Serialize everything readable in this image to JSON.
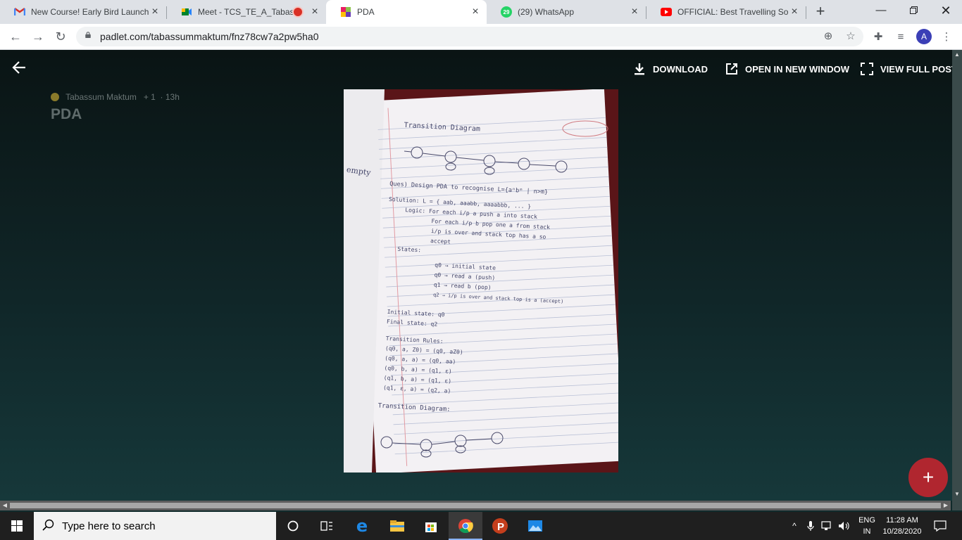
{
  "browser": {
    "tabs": [
      {
        "title": "New Course! Early Bird Launch",
        "icon": "gmail-icon",
        "active": false
      },
      {
        "title": "Meet - TCS_TE_A_Tabassum",
        "icon": "google-meet-icon",
        "active": false,
        "recording": true
      },
      {
        "title": "PDA",
        "icon": "padlet-icon",
        "active": true
      },
      {
        "title": "(29) WhatsApp",
        "icon": "whatsapp-icon",
        "active": false,
        "badge": "29"
      },
      {
        "title": "OFFICIAL: Best Travelling Song",
        "icon": "youtube-icon",
        "active": false
      }
    ],
    "new_tab_label": "+",
    "url": "padlet.com/tabassummaktum/fnz78cw7a2pw5ha0",
    "avatar_initial": "A"
  },
  "viewer": {
    "actions": {
      "download": "DOWNLOAD",
      "open_new_window": "OPEN IN NEW WINDOW",
      "view_full_post": "VIEW FULL POST"
    },
    "author": "Tabassum Maktum",
    "likes": "+ 1",
    "age": "13h",
    "post_title": "PDA",
    "fab_label": "+",
    "notebook": {
      "heading1": "Transition Diagram",
      "question": "Ques) Design PDA to recognise L={aⁿbᵐ | n>m}",
      "solution": "Solution: L = { aab, aaabb, aaaabbb, ... }",
      "logic_lines": [
        "Logic: For each i/p a push a into stack",
        "For each i/p b pop one a from stack",
        "i/p is over and stack top has a so",
        "accept"
      ],
      "states_label": "States:",
      "states": [
        "q0 → initial state",
        "q0 → read a (push)",
        "q1 → read b (pop)",
        "q2 → i/p is over and stack top is a (accept)"
      ],
      "initial_state": "Initial state: q0",
      "final_state": "Final state: q2",
      "rules_label": "Transition Rules:",
      "rules": [
        "(q0, a, Z0) = (q0, aZ0)",
        "(q0, a, a) = (q0, aa)",
        "(q0, b, a) = (q1, ε)",
        "(q1, b, a) = (q1, ε)",
        "(q1, ε, a) = (q2, a)"
      ],
      "heading2": "Transition Diagram:",
      "margin_word": "empty"
    }
  },
  "taskbar": {
    "search_placeholder": "Type here to search",
    "language_top": "ENG",
    "language_bottom": "IN",
    "time": "11:28 AM",
    "date": "10/28/2020",
    "apps": [
      "task-view-icon",
      "cortana-icon",
      "edge-icon",
      "file-explorer-icon",
      "store-icon",
      "chrome-icon",
      "powerpoint-icon",
      "photos-icon"
    ]
  },
  "colors": {
    "viewer_bg": "#102a2b",
    "fab": "#b0262f",
    "photo_bg": "#5a1518"
  }
}
